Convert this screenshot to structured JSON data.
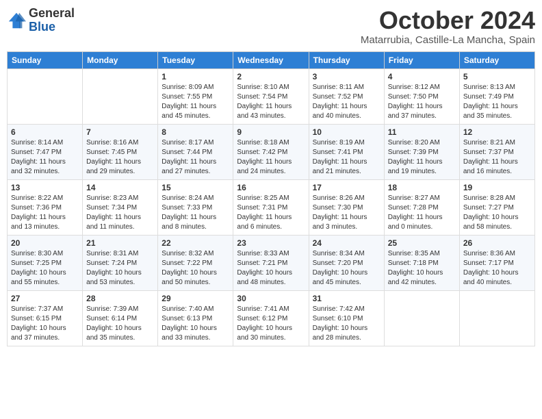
{
  "logo": {
    "line1": "General",
    "line2": "Blue"
  },
  "title": "October 2024",
  "location": "Matarrubia, Castille-La Mancha, Spain",
  "headers": [
    "Sunday",
    "Monday",
    "Tuesday",
    "Wednesday",
    "Thursday",
    "Friday",
    "Saturday"
  ],
  "weeks": [
    [
      {
        "day": "",
        "detail": ""
      },
      {
        "day": "",
        "detail": ""
      },
      {
        "day": "1",
        "detail": "Sunrise: 8:09 AM\nSunset: 7:55 PM\nDaylight: 11 hours and 45 minutes."
      },
      {
        "day": "2",
        "detail": "Sunrise: 8:10 AM\nSunset: 7:54 PM\nDaylight: 11 hours and 43 minutes."
      },
      {
        "day": "3",
        "detail": "Sunrise: 8:11 AM\nSunset: 7:52 PM\nDaylight: 11 hours and 40 minutes."
      },
      {
        "day": "4",
        "detail": "Sunrise: 8:12 AM\nSunset: 7:50 PM\nDaylight: 11 hours and 37 minutes."
      },
      {
        "day": "5",
        "detail": "Sunrise: 8:13 AM\nSunset: 7:49 PM\nDaylight: 11 hours and 35 minutes."
      }
    ],
    [
      {
        "day": "6",
        "detail": "Sunrise: 8:14 AM\nSunset: 7:47 PM\nDaylight: 11 hours and 32 minutes."
      },
      {
        "day": "7",
        "detail": "Sunrise: 8:16 AM\nSunset: 7:45 PM\nDaylight: 11 hours and 29 minutes."
      },
      {
        "day": "8",
        "detail": "Sunrise: 8:17 AM\nSunset: 7:44 PM\nDaylight: 11 hours and 27 minutes."
      },
      {
        "day": "9",
        "detail": "Sunrise: 8:18 AM\nSunset: 7:42 PM\nDaylight: 11 hours and 24 minutes."
      },
      {
        "day": "10",
        "detail": "Sunrise: 8:19 AM\nSunset: 7:41 PM\nDaylight: 11 hours and 21 minutes."
      },
      {
        "day": "11",
        "detail": "Sunrise: 8:20 AM\nSunset: 7:39 PM\nDaylight: 11 hours and 19 minutes."
      },
      {
        "day": "12",
        "detail": "Sunrise: 8:21 AM\nSunset: 7:37 PM\nDaylight: 11 hours and 16 minutes."
      }
    ],
    [
      {
        "day": "13",
        "detail": "Sunrise: 8:22 AM\nSunset: 7:36 PM\nDaylight: 11 hours and 13 minutes."
      },
      {
        "day": "14",
        "detail": "Sunrise: 8:23 AM\nSunset: 7:34 PM\nDaylight: 11 hours and 11 minutes."
      },
      {
        "day": "15",
        "detail": "Sunrise: 8:24 AM\nSunset: 7:33 PM\nDaylight: 11 hours and 8 minutes."
      },
      {
        "day": "16",
        "detail": "Sunrise: 8:25 AM\nSunset: 7:31 PM\nDaylight: 11 hours and 6 minutes."
      },
      {
        "day": "17",
        "detail": "Sunrise: 8:26 AM\nSunset: 7:30 PM\nDaylight: 11 hours and 3 minutes."
      },
      {
        "day": "18",
        "detail": "Sunrise: 8:27 AM\nSunset: 7:28 PM\nDaylight: 11 hours and 0 minutes."
      },
      {
        "day": "19",
        "detail": "Sunrise: 8:28 AM\nSunset: 7:27 PM\nDaylight: 10 hours and 58 minutes."
      }
    ],
    [
      {
        "day": "20",
        "detail": "Sunrise: 8:30 AM\nSunset: 7:25 PM\nDaylight: 10 hours and 55 minutes."
      },
      {
        "day": "21",
        "detail": "Sunrise: 8:31 AM\nSunset: 7:24 PM\nDaylight: 10 hours and 53 minutes."
      },
      {
        "day": "22",
        "detail": "Sunrise: 8:32 AM\nSunset: 7:22 PM\nDaylight: 10 hours and 50 minutes."
      },
      {
        "day": "23",
        "detail": "Sunrise: 8:33 AM\nSunset: 7:21 PM\nDaylight: 10 hours and 48 minutes."
      },
      {
        "day": "24",
        "detail": "Sunrise: 8:34 AM\nSunset: 7:20 PM\nDaylight: 10 hours and 45 minutes."
      },
      {
        "day": "25",
        "detail": "Sunrise: 8:35 AM\nSunset: 7:18 PM\nDaylight: 10 hours and 42 minutes."
      },
      {
        "day": "26",
        "detail": "Sunrise: 8:36 AM\nSunset: 7:17 PM\nDaylight: 10 hours and 40 minutes."
      }
    ],
    [
      {
        "day": "27",
        "detail": "Sunrise: 7:37 AM\nSunset: 6:15 PM\nDaylight: 10 hours and 37 minutes."
      },
      {
        "day": "28",
        "detail": "Sunrise: 7:39 AM\nSunset: 6:14 PM\nDaylight: 10 hours and 35 minutes."
      },
      {
        "day": "29",
        "detail": "Sunrise: 7:40 AM\nSunset: 6:13 PM\nDaylight: 10 hours and 33 minutes."
      },
      {
        "day": "30",
        "detail": "Sunrise: 7:41 AM\nSunset: 6:12 PM\nDaylight: 10 hours and 30 minutes."
      },
      {
        "day": "31",
        "detail": "Sunrise: 7:42 AM\nSunset: 6:10 PM\nDaylight: 10 hours and 28 minutes."
      },
      {
        "day": "",
        "detail": ""
      },
      {
        "day": "",
        "detail": ""
      }
    ]
  ]
}
